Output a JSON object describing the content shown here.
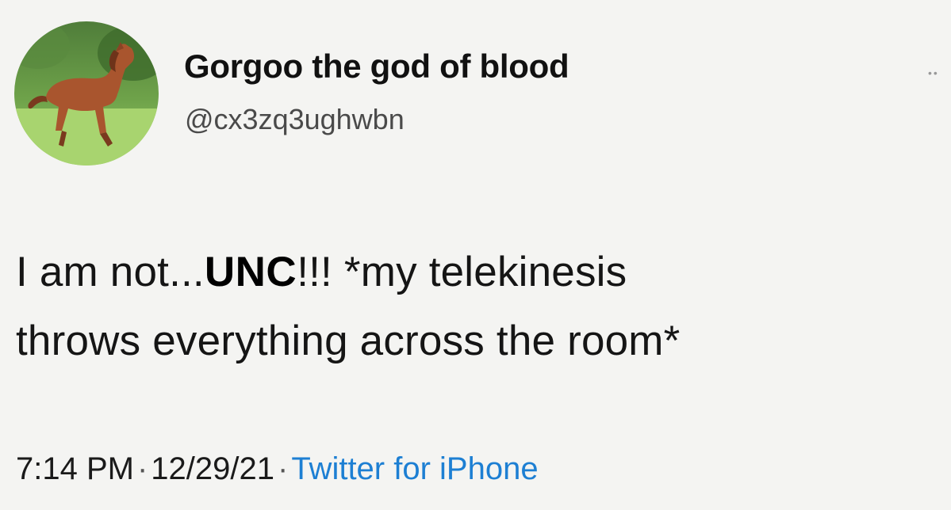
{
  "user": {
    "display_name": "Gorgoo the god of blood",
    "handle": "@cx3zq3ughwbn",
    "avatar_icon": "horse-avatar"
  },
  "tweet": {
    "text_before": "I am not...",
    "text_emphasis": "UNC",
    "text_after_line1": "!!! *my telekinesis",
    "text_line2": "throws everything across the room*"
  },
  "meta": {
    "time": "7:14 PM",
    "separator": "·",
    "date": "12/29/21",
    "source": "Twitter for iPhone"
  },
  "colors": {
    "background": "#f4f4f2",
    "source_link": "#1d7fd3",
    "handle": "#4a4a4a"
  }
}
